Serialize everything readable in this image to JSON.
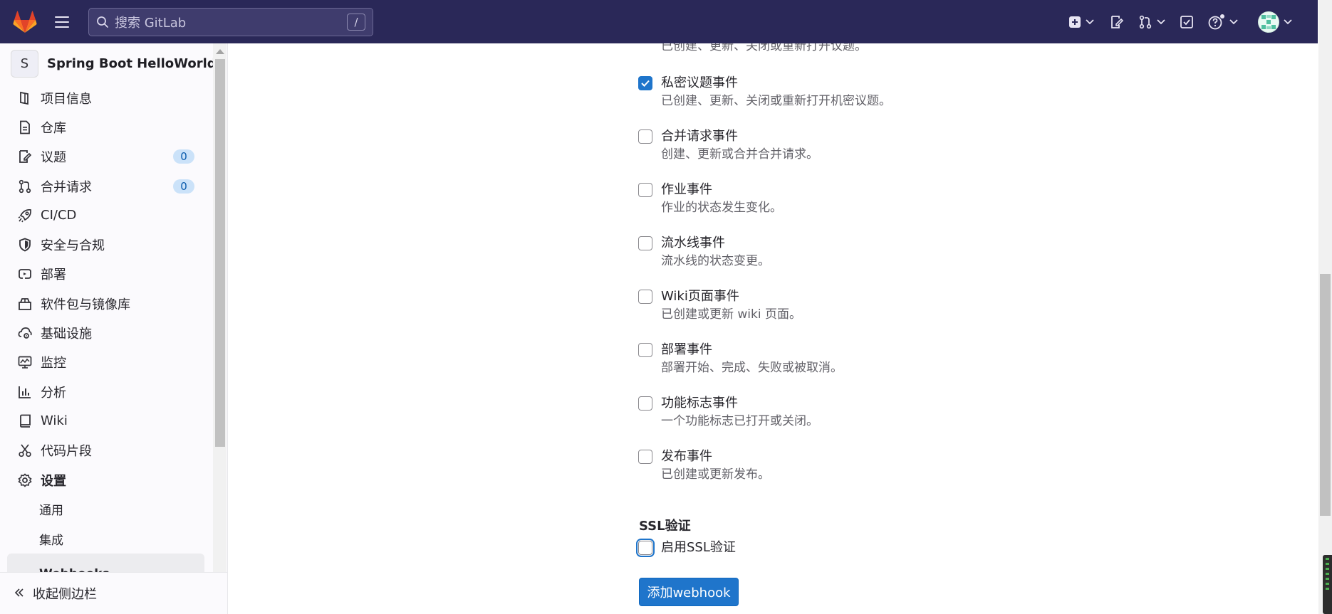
{
  "header": {
    "search_placeholder": "搜索 GitLab",
    "search_shortcut": "/"
  },
  "sidebar": {
    "project_initial": "S",
    "project_name": "Spring Boot HelloWorld",
    "items": [
      {
        "label": "项目信息",
        "icon": "project-info-icon"
      },
      {
        "label": "仓库",
        "icon": "repository-icon"
      },
      {
        "label": "议题",
        "icon": "issues-icon",
        "badge": "0"
      },
      {
        "label": "合并请求",
        "icon": "merge-request-icon",
        "badge": "0"
      },
      {
        "label": "CI/CD",
        "icon": "rocket-icon"
      },
      {
        "label": "安全与合规",
        "icon": "shield-icon"
      },
      {
        "label": "部署",
        "icon": "deploy-icon"
      },
      {
        "label": "软件包与镜像库",
        "icon": "package-icon"
      },
      {
        "label": "基础设施",
        "icon": "cloud-gear-icon"
      },
      {
        "label": "监控",
        "icon": "monitor-icon"
      },
      {
        "label": "分析",
        "icon": "chart-icon"
      },
      {
        "label": "Wiki",
        "icon": "book-icon"
      },
      {
        "label": "代码片段",
        "icon": "scissors-icon"
      },
      {
        "label": "设置",
        "icon": "gear-icon"
      }
    ],
    "sub_items": [
      {
        "label": "通用"
      },
      {
        "label": "集成"
      },
      {
        "label": "Webhooks",
        "active": true
      }
    ],
    "collapse_label": "收起侧边栏"
  },
  "content": {
    "partial_text": "已创建、更新、关闭或重新打开议题。",
    "events": [
      {
        "title": "私密议题事件",
        "desc": "已创建、更新、关闭或重新打开机密议题。",
        "checked": true
      },
      {
        "title": "合并请求事件",
        "desc": "创建、更新或合并合并请求。",
        "checked": false
      },
      {
        "title": "作业事件",
        "desc": "作业的状态发生变化。",
        "checked": false
      },
      {
        "title": "流水线事件",
        "desc": "流水线的状态变更。",
        "checked": false
      },
      {
        "title": "Wiki页面事件",
        "desc": "已创建或更新 wiki 页面。",
        "checked": false
      },
      {
        "title": "部署事件",
        "desc": "部署开始、完成、失败或被取消。",
        "checked": false
      },
      {
        "title": "功能标志事件",
        "desc": "一个功能标志已打开或关闭。",
        "checked": false
      },
      {
        "title": "发布事件",
        "desc": "已创建或更新发布。",
        "checked": false
      }
    ],
    "ssl_heading": "SSL验证",
    "ssl_label": "启用SSL验证",
    "ssl_checked": false,
    "submit_label": "添加webhook"
  },
  "colors": {
    "topbar": "#2a2858",
    "primary": "#1f75cb",
    "badge_bg": "#cbe2f9"
  }
}
